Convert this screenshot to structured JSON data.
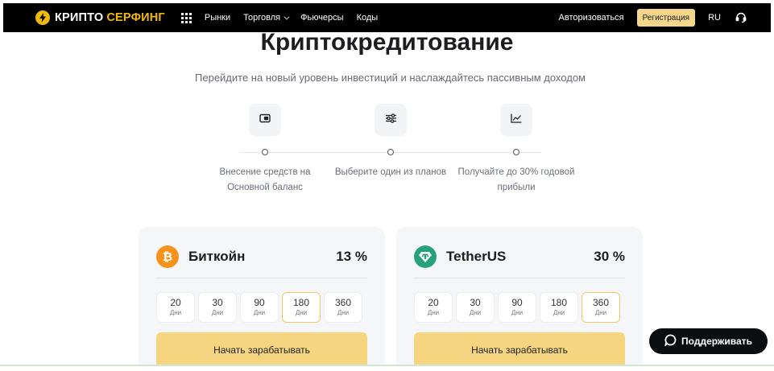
{
  "header": {
    "brand_first": "КРИПТО",
    "brand_second": "СЕРФИНГ",
    "nav": [
      {
        "label": "Рынки"
      },
      {
        "label": "Торговля"
      },
      {
        "label": "Фьючерсы"
      },
      {
        "label": "Коды"
      }
    ],
    "login_label": "Авторизоваться",
    "register_label": "Регистрация",
    "language": "RU",
    "icons": {
      "logo": "lightning-icon",
      "apps": "grid-icon",
      "dropdown": "chevron-down-icon",
      "support": "headset-icon"
    }
  },
  "hero": {
    "title": "Криптокредитование",
    "subtitle": "Перейдите на новый уровень инвестиций и наслаждайтесь пассивным доходом"
  },
  "steps": [
    {
      "icon": "wallet-icon",
      "line1": "Внесение средств на",
      "line2": "Основной баланс"
    },
    {
      "icon": "sliders-icon",
      "line1": "Выберите один из планов",
      "line2": ""
    },
    {
      "icon": "chart-line-icon",
      "line1": "Получайте до 30% годовой",
      "line2": "прибыли"
    }
  ],
  "products": [
    {
      "icon": "bitcoin-icon",
      "name": "Биткойн",
      "rate": "13 %",
      "periods": [
        {
          "days": "20",
          "unit": "Дни"
        },
        {
          "days": "30",
          "unit": "Дни"
        },
        {
          "days": "90",
          "unit": "Дни"
        },
        {
          "days": "180",
          "unit": "Дни"
        },
        {
          "days": "360",
          "unit": "Дни"
        }
      ],
      "selected_period": "180",
      "cta": "Начать зарабатывать"
    },
    {
      "icon": "tether-icon",
      "name": "TetherUS",
      "rate": "30 %",
      "periods": [
        {
          "days": "20",
          "unit": "Дни"
        },
        {
          "days": "30",
          "unit": "Дни"
        },
        {
          "days": "90",
          "unit": "Дни"
        },
        {
          "days": "180",
          "unit": "Дни"
        },
        {
          "days": "360",
          "unit": "Дни"
        }
      ],
      "selected_period": "360",
      "cta": "Начать зарабатывать"
    }
  ],
  "support_button": {
    "icon": "chat-bubble-icon",
    "label": "Поддерживать"
  },
  "colors": {
    "header_bg": "#000000",
    "brand_accent": "#f0b90b",
    "register_bg": "#f5d78c",
    "cta_bg": "#f5d580",
    "card_bg": "#f5f6f8",
    "bitcoin": "#f7931a",
    "tether": "#26a17b",
    "selected_border": "#f0c86a"
  }
}
